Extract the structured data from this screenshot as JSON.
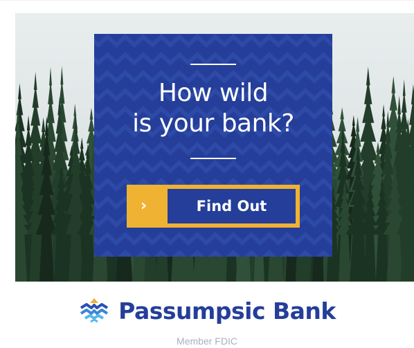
{
  "ad": {
    "headline_line1": "How wild",
    "headline_line2": "is your bank?",
    "cta_label": "Find Out",
    "cta_arrow_icon": "chevron-right-icon",
    "brand_name": "Passumpsic Bank",
    "member_text": "Member FDIC",
    "logo_icon": "wave-mountain-icon"
  },
  "colors": {
    "panel_blue": "#243e99",
    "cta_yellow": "#f0b232",
    "forest_green": "#1d3524",
    "sky": "#dfe6e8"
  }
}
